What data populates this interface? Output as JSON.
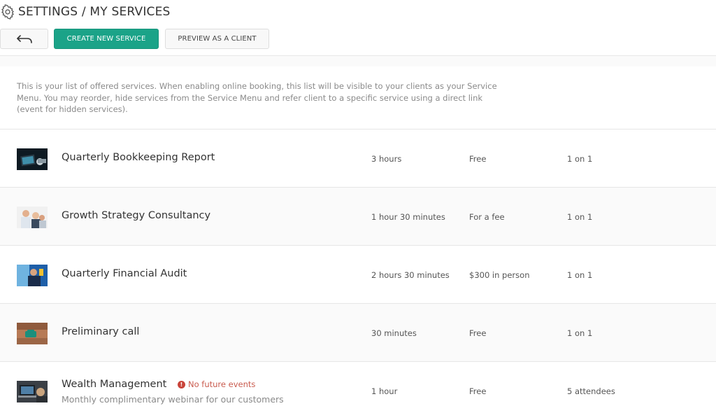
{
  "header": {
    "title": "SETTINGS / MY SERVICES",
    "buttons": {
      "create_label": "CREATE NEW SERVICE",
      "preview_label": "PREVIEW AS A CLIENT"
    }
  },
  "intro": {
    "text": "This is your list of offered services. When enabling online booking, this list will be visible to your clients as your Service Menu. You may reorder, hide services from the Service Menu and refer client to a specific service using a direct link (event for hidden services)."
  },
  "services": [
    {
      "name": "Quarterly Bookkeeping Report",
      "duration": "3 hours",
      "price": "Free",
      "attendees": "1 on 1"
    },
    {
      "name": "Growth Strategy Consultancy",
      "duration": "1 hour 30 minutes",
      "price": "For a fee",
      "attendees": "1 on 1"
    },
    {
      "name": "Quarterly Financial Audit",
      "duration": "2 hours 30 minutes",
      "price": "$300 in person",
      "attendees": "1 on 1"
    },
    {
      "name": "Preliminary call",
      "duration": "30 minutes",
      "price": "Free",
      "attendees": "1 on 1"
    },
    {
      "name": "Wealth Management",
      "warning": "No future events",
      "description": "Monthly complimentary webinar for our customers",
      "duration": "1 hour",
      "price": "Free",
      "attendees": "5 attendees"
    }
  ],
  "colors": {
    "accent": "#1ba388",
    "warning": "#c9443a"
  }
}
